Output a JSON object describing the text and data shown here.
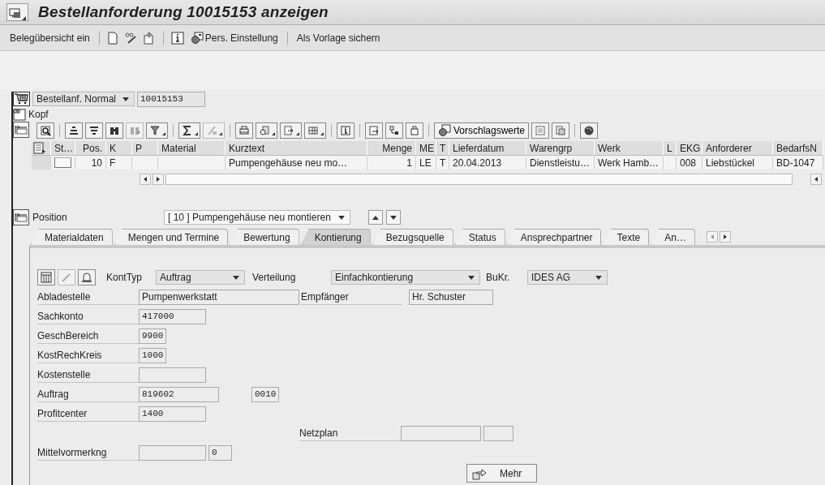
{
  "window": {
    "title": "Bestellanforderung 10015153 anzeigen"
  },
  "toolbar": {
    "items": [
      "Belegübersicht ein",
      "Pers. Einstellung",
      "Als Vorlage sichern"
    ]
  },
  "document": {
    "type": "Bestellanf. Normal",
    "number": "10015153"
  },
  "header_section": {
    "label": "Kopf"
  },
  "items": {
    "proposal_button": "Vorschlagswerte",
    "columns": [
      "St…",
      "Pos.",
      "K",
      "P",
      "Material",
      "Kurztext",
      "Menge",
      "ME",
      "T",
      "Lieferdatum",
      "Warengrp",
      "Werk",
      "L",
      "EKG",
      "Anforderer",
      "BedarfsN"
    ],
    "rows": [
      {
        "cells": [
          null,
          "10",
          "F",
          null,
          null,
          "Pumpengehäuse neu mo…",
          "1",
          "LE",
          "T",
          "20.04.2013",
          "Dienstleistu…",
          "Werk Hamb…",
          null,
          "008",
          "Liebstückel",
          "BD-1047"
        ]
      }
    ]
  },
  "position": {
    "label": "Position",
    "value": "[ 10 ] Pumpengehäuse neu montieren"
  },
  "tabs": [
    {
      "label": "Materialdaten",
      "selected": false
    },
    {
      "label": "Mengen und Termine",
      "selected": false
    },
    {
      "label": "Bewertung",
      "selected": false
    },
    {
      "label": "Kontierung",
      "selected": true
    },
    {
      "label": "Bezugsquelle",
      "selected": false
    },
    {
      "label": "Status",
      "selected": false
    },
    {
      "label": "Ansprechpartner",
      "selected": false
    },
    {
      "label": "Texte",
      "selected": false
    },
    {
      "label": "An…",
      "selected": false
    }
  ],
  "account_assignment": {
    "account_type": {
      "label": "KontTyp",
      "value": "Auftrag"
    },
    "distribution": {
      "label": "Verteilung",
      "value": "Einfachkontierung"
    },
    "company_code": {
      "label": "BuKr.",
      "value": "IDES AG"
    },
    "unloading_point": {
      "label": "Abladestelle",
      "value": "Pumpenwerkstatt"
    },
    "recipient": {
      "label": "Empfänger",
      "value": "Hr. Schuster"
    },
    "fields": [
      {
        "label": "Sachkonto",
        "value": "417000"
      },
      {
        "label": "GeschBereich",
        "value": "9900"
      },
      {
        "label": "KostRechKreis",
        "value": "1000"
      },
      {
        "label": "Kostenstelle"
      },
      {
        "label": "Auftrag",
        "value": "819602",
        "extra": "0010"
      },
      {
        "label": "Profitcenter",
        "value": "1400"
      }
    ],
    "network": {
      "label": "Netzplan"
    },
    "funds": {
      "label": "Mittelvormerkng",
      "extra": "0"
    },
    "more_button": "Mehr"
  }
}
